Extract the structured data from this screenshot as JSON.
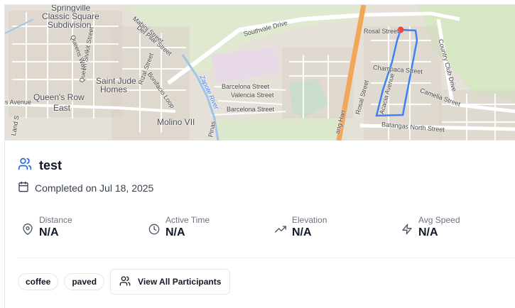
{
  "map": {
    "labels": {
      "springville": "Springville",
      "classic_square": "Classic Square",
      "subdivision": "Subdivision",
      "southvale_drive": "Southvale Drive",
      "mabini_street": "Mabini Street",
      "del_pilar_street": "Del Pilar Street",
      "rizal_street": "Rizal Street",
      "queen_sivikit_street": "Queen Sivikit Street",
      "queens_way": "Queens Way",
      "saint_jude": "Saint Jude",
      "homes": "Homes",
      "queens_row": "Queen's Row",
      "east": "East",
      "s_avenue": "s Avenue",
      "bonifacio_loop": "Bonifacio Loop",
      "molino_vii": "Molino VII",
      "zapote_river": "Zapote River",
      "pinas": "Pinas",
      "barcelona_street_1": "Barcelona Street",
      "valencia_street": "Valencia Street",
      "barcelona_street_2": "Barcelona Street",
      "rosal_street_top": "Rosal Street",
      "rosal_street_side": "Rosal Street",
      "champaca_street": "Champaca Street",
      "acacia_avenue": "Acacia Avenue",
      "country_club_drive": "Country Club Drive",
      "camelia_street": "Camelia Street",
      "batangas_north_street": "Batangas North Street",
      "daang_hari": "ang Hari",
      "land_street": "Land S"
    },
    "route_color": "#3b82f6",
    "marker_color": "#ef4444"
  },
  "activity": {
    "title": "test",
    "completed": "Completed on Jul 18, 2025"
  },
  "stats": [
    {
      "label": "Distance",
      "value": "N/A",
      "icon": "map-pin-icon"
    },
    {
      "label": "Active Time",
      "value": "N/A",
      "icon": "clock-icon"
    },
    {
      "label": "Elevation",
      "value": "N/A",
      "icon": "trending-up-icon"
    },
    {
      "label": "Avg Speed",
      "value": "N/A",
      "icon": "zap-icon"
    }
  ],
  "tags": [
    "coffee",
    "paved"
  ],
  "participants_button": "View All Participants",
  "colors": {
    "accent": "#2563eb",
    "text": "#111827",
    "muted": "#6b7280",
    "border": "#e5e7eb"
  }
}
